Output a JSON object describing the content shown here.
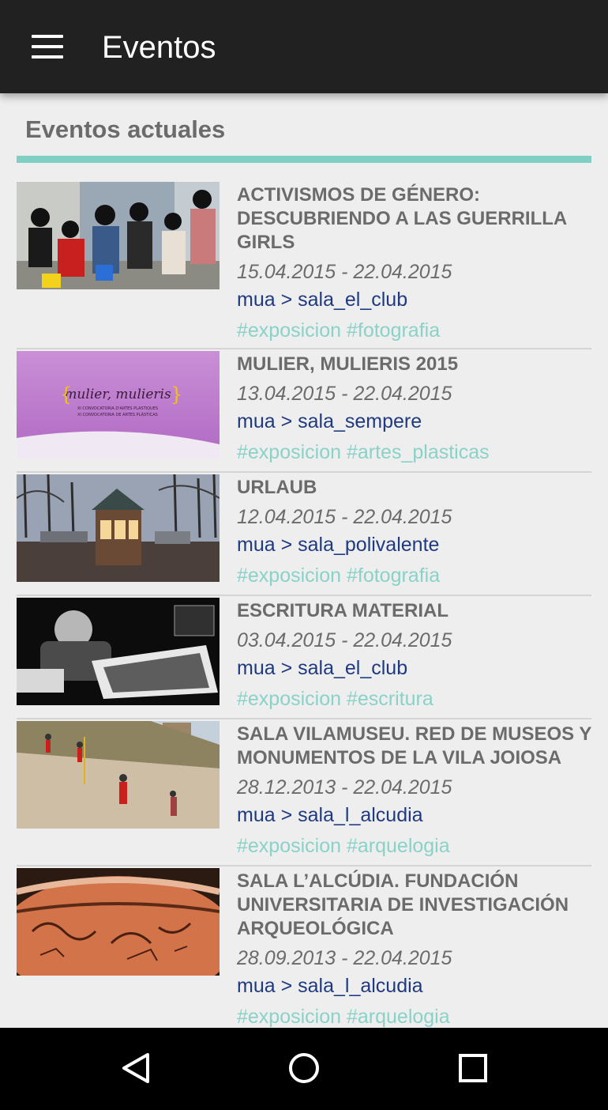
{
  "app_bar": {
    "title": "Eventos",
    "menu_icon": "hamburger-menu-icon"
  },
  "section": {
    "title": "Eventos actuales",
    "accent_color": "#80cfc5"
  },
  "events": [
    {
      "title": "ACTIVISMOS DE GÉNERO: DESCUBRIENDO A LAS GUERRILLA GIRLS",
      "dates": "15.04.2015 - 22.04.2015",
      "location": "mua > sala_el_club",
      "tags": "#exposicion #fotografia"
    },
    {
      "title": "MULIER, MULIERIS 2015",
      "dates": "13.04.2015 - 22.04.2015",
      "location": "mua > sala_sempere",
      "tags": "#exposicion #artes_plasticas",
      "thumb_text": {
        "name": "mulier, mulieris",
        "line1": "XI CONVOCATORIA D'ARTES PLASTIQUES",
        "line2": "XI CONVOCATORIA DE ARTES PLÁSTICAS"
      }
    },
    {
      "title": "URLAUB",
      "dates": "12.04.2015 - 22.04.2015",
      "location": "mua > sala_polivalente",
      "tags": "#exposicion #fotografia"
    },
    {
      "title": "ESCRITURA MATERIAL",
      "dates": "03.04.2015 - 22.04.2015",
      "location": "mua > sala_el_club",
      "tags": "#exposicion #escritura"
    },
    {
      "title": "SALA VILAMUSEU. RED DE MUSEOS Y MONUMENTOS DE LA VILA JOIOSA",
      "dates": "28.12.2013 - 22.04.2015",
      "location": "mua > sala_l_alcudia",
      "tags": "#exposicion #arquelogia"
    },
    {
      "title": "SALA L’ALCÚDIA. FUNDACIÓN UNIVERSITARIA DE INVESTIGACIÓN ARQUEOLÓGICA",
      "dates": "28.09.2013 - 22.04.2015",
      "location": "mua > sala_l_alcudia",
      "tags": "#exposicion #arquelogia"
    }
  ],
  "nav_bar": {
    "back_icon": "back-triangle-icon",
    "home_icon": "home-circle-icon",
    "recents_icon": "recents-square-icon"
  },
  "colors": {
    "app_bar": "#212121",
    "background": "#eeeeee",
    "title_text": "#6b6b6b",
    "location_text": "#1f3a80",
    "tag_text": "#8ad2c8"
  }
}
